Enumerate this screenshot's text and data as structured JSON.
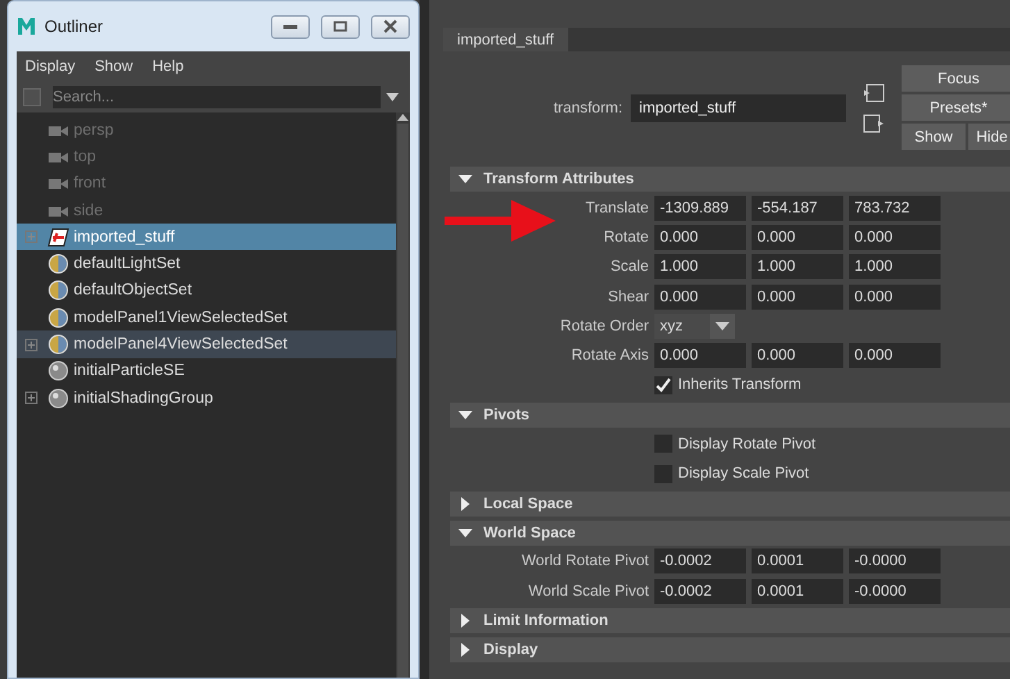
{
  "outliner": {
    "title": "Outliner",
    "menu": [
      "Display",
      "Show",
      "Help"
    ],
    "search": {
      "placeholder": "Search..."
    },
    "items": [
      {
        "label": "persp",
        "kind": "camera",
        "dimmed": true,
        "expandable": false,
        "selected": false,
        "highlighted": false
      },
      {
        "label": "top",
        "kind": "camera",
        "dimmed": true,
        "expandable": false,
        "selected": false,
        "highlighted": false
      },
      {
        "label": "front",
        "kind": "camera",
        "dimmed": true,
        "expandable": false,
        "selected": false,
        "highlighted": false
      },
      {
        "label": "side",
        "kind": "camera",
        "dimmed": true,
        "expandable": false,
        "selected": false,
        "highlighted": false
      },
      {
        "label": "imported_stuff",
        "kind": "transform",
        "dimmed": false,
        "expandable": true,
        "selected": true,
        "highlighted": false
      },
      {
        "label": "defaultLightSet",
        "kind": "set",
        "dimmed": false,
        "expandable": false,
        "selected": false,
        "highlighted": false
      },
      {
        "label": "defaultObjectSet",
        "kind": "set",
        "dimmed": false,
        "expandable": false,
        "selected": false,
        "highlighted": false
      },
      {
        "label": "modelPanel1ViewSelectedSet",
        "kind": "set",
        "dimmed": false,
        "expandable": false,
        "selected": false,
        "highlighted": false
      },
      {
        "label": "modelPanel4ViewSelectedSet",
        "kind": "set",
        "dimmed": false,
        "expandable": true,
        "selected": false,
        "highlighted": true
      },
      {
        "label": "initialParticleSE",
        "kind": "shading",
        "dimmed": false,
        "expandable": false,
        "selected": false,
        "highlighted": false
      },
      {
        "label": "initialShadingGroup",
        "kind": "shading",
        "dimmed": false,
        "expandable": true,
        "selected": false,
        "highlighted": false
      }
    ]
  },
  "attribute_editor": {
    "tab": "imported_stuff",
    "node_label": "transform:",
    "node_name": "imported_stuff",
    "buttons": {
      "focus": "Focus",
      "presets": "Presets*",
      "show": "Show",
      "hide": "Hide"
    },
    "sections": [
      {
        "title": "Transform Attributes",
        "expanded": true,
        "rows": [
          {
            "kind": "vector",
            "label": "Translate",
            "values": [
              "-1309.889",
              "-554.187",
              "783.732"
            ]
          },
          {
            "kind": "vector",
            "label": "Rotate",
            "values": [
              "0.000",
              "0.000",
              "0.000"
            ]
          },
          {
            "kind": "vector",
            "label": "Scale",
            "values": [
              "1.000",
              "1.000",
              "1.000"
            ]
          },
          {
            "kind": "vector",
            "label": "Shear",
            "values": [
              "0.000",
              "0.000",
              "0.000"
            ]
          },
          {
            "kind": "dropdown",
            "label": "Rotate Order",
            "value": "xyz"
          },
          {
            "kind": "vector",
            "label": "Rotate Axis",
            "values": [
              "0.000",
              "0.000",
              "0.000"
            ]
          },
          {
            "kind": "checkbox",
            "label": "Inherits Transform",
            "checked": true
          }
        ]
      },
      {
        "title": "Pivots",
        "expanded": true,
        "rows": [
          {
            "kind": "checkbox",
            "label": "Display Rotate Pivot",
            "checked": false
          },
          {
            "kind": "checkbox",
            "label": "Display Scale Pivot",
            "checked": false
          }
        ]
      },
      {
        "title": "Local Space",
        "expanded": false
      },
      {
        "title": "World Space",
        "expanded": true,
        "rows": [
          {
            "kind": "vector",
            "label": "World Rotate Pivot",
            "values": [
              "-0.0002",
              "0.0001",
              "-0.0000"
            ]
          },
          {
            "kind": "vector",
            "label": "World Scale Pivot",
            "values": [
              "-0.0002",
              "0.0001",
              "-0.0000"
            ]
          }
        ]
      },
      {
        "title": "Limit Information",
        "expanded": false
      },
      {
        "title": "Display",
        "expanded": false
      }
    ]
  }
}
